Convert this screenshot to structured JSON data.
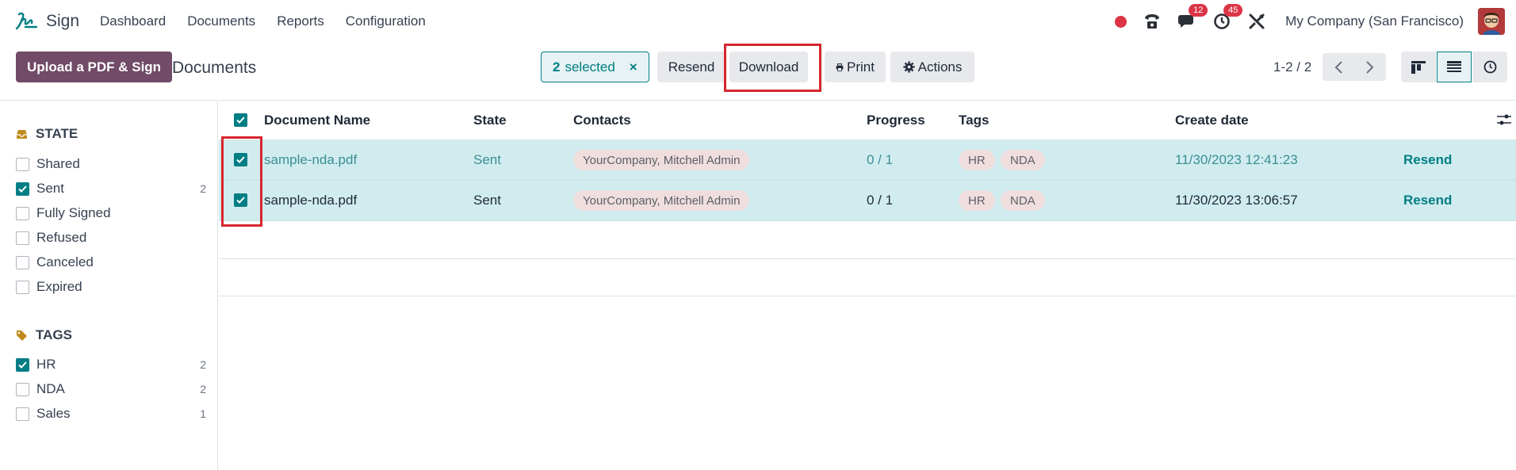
{
  "navbar": {
    "app_name": "Sign",
    "menu": [
      "Dashboard",
      "Documents",
      "Reports",
      "Configuration"
    ],
    "messages_badge": "12",
    "activities_badge": "45",
    "company": "My Company (San Francisco)"
  },
  "control": {
    "upload_label": "Upload a PDF & Sign",
    "title": "Documents",
    "selected_count": "2",
    "selected_label": "selected",
    "close_symbol": "×",
    "resend_label": "Resend",
    "download_label": "Download",
    "print_label": "Print",
    "actions_label": "Actions",
    "pager": "1-2 / 2"
  },
  "sidebar": {
    "state_header": "STATE",
    "state_items": [
      {
        "label": "Shared",
        "checked": false,
        "count": ""
      },
      {
        "label": "Sent",
        "checked": true,
        "count": "2"
      },
      {
        "label": "Fully Signed",
        "checked": false,
        "count": ""
      },
      {
        "label": "Refused",
        "checked": false,
        "count": ""
      },
      {
        "label": "Canceled",
        "checked": false,
        "count": ""
      },
      {
        "label": "Expired",
        "checked": false,
        "count": ""
      }
    ],
    "tags_header": "TAGS",
    "tag_items": [
      {
        "label": "HR",
        "checked": true,
        "count": "2"
      },
      {
        "label": "NDA",
        "checked": false,
        "count": "2"
      },
      {
        "label": "Sales",
        "checked": false,
        "count": "1"
      }
    ]
  },
  "table": {
    "headers": [
      "Document Name",
      "State",
      "Contacts",
      "Progress",
      "Tags",
      "Create date"
    ],
    "rows": [
      {
        "name": "sample-nda.pdf",
        "state": "Sent",
        "contacts": "YourCompany, Mitchell Admin",
        "progress": "0 / 1",
        "tags": [
          "HR",
          "NDA"
        ],
        "date": "11/30/2023 12:41:23",
        "action": "Resend"
      },
      {
        "name": "sample-nda.pdf",
        "state": "Sent",
        "contacts": "YourCompany, Mitchell Admin",
        "progress": "0 / 1",
        "tags": [
          "HR",
          "NDA"
        ],
        "date": "11/30/2023 13:06:57",
        "action": "Resend"
      }
    ]
  },
  "colors": {
    "brand": "#714b67",
    "accent": "#017e84",
    "selected_row": "#d1ecef",
    "highlight": "#d7262e"
  }
}
